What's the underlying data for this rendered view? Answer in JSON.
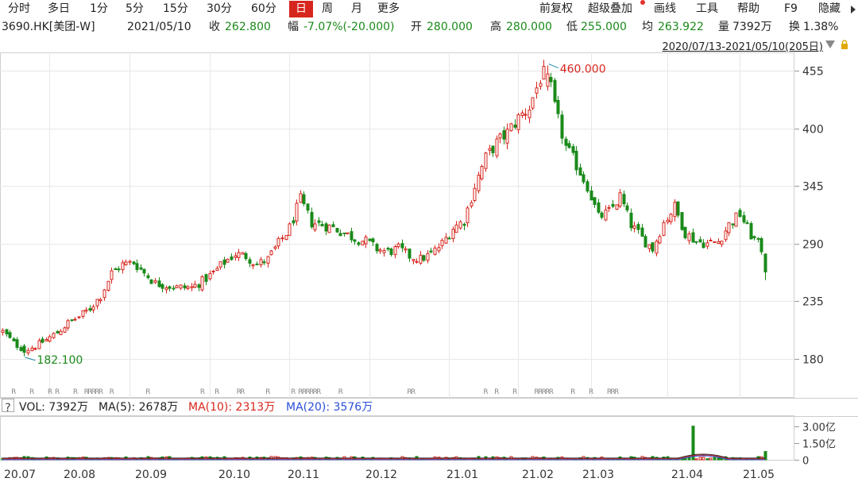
{
  "toolbar": {
    "left_items": [
      "分时",
      "多日",
      "1分",
      "5分",
      "15分",
      "30分",
      "60分",
      "日",
      "周",
      "月",
      "更多"
    ],
    "active": "日",
    "right_items": [
      "前复权",
      "超级叠加",
      "画线",
      "工具",
      "帮助",
      "F9",
      "隐藏"
    ]
  },
  "quote": {
    "code_name": "3690.HK[美团-W]",
    "date": "2021/05/10",
    "close_label": "收",
    "close": "262.800",
    "change_label": "幅",
    "change": "-7.07%(-20.000)",
    "open_label": "开",
    "open": "280.000",
    "high_label": "高",
    "high": "280.000",
    "low_label": "低",
    "low": "255.000",
    "avg_label": "均",
    "avg": "263.922",
    "vol_label": "量",
    "vol": "7392万",
    "turnover_label": "换",
    "turnover": "1.38%"
  },
  "range_text": "2020/07/13-2021/05/10(205日)",
  "volume_indicator": {
    "qmark": "?",
    "vol": "VOL: 7392万",
    "ma5": "MA(5): 2678万",
    "ma10": "MA(10): 2313万",
    "ma20": "MA(20): 3576万"
  },
  "colors": {
    "up": "#d7261e",
    "down": "#1a8a1a",
    "ma5": "#222222",
    "ma10": "#d7261e",
    "ma20": "#2b4fd8"
  },
  "chart_data": {
    "type": "candlestick",
    "title": "",
    "ylim": [
      160,
      468
    ],
    "y_ticks": [
      "455",
      "400",
      "345",
      "290",
      "235",
      "180"
    ],
    "y_tick_values": [
      455,
      400,
      345,
      290,
      235,
      180
    ],
    "x_ticks": [
      "20.07",
      "20.08",
      "20.09",
      "20.10",
      "20.11",
      "20.12",
      "21.01",
      "21.02",
      "21.03",
      "21.04",
      "21.05"
    ],
    "annotations": [
      {
        "text": "460.000",
        "value": 460,
        "color": "#d7261e",
        "kind": "high"
      },
      {
        "text": "182.100",
        "value": 182.1,
        "color": "#1a8a1a",
        "kind": "low"
      }
    ],
    "rights_marker": "R",
    "rights_markers_x_index": [
      2,
      7,
      12,
      14,
      19,
      22,
      23,
      24,
      25,
      26,
      29,
      39,
      54,
      58,
      64,
      65,
      72,
      79,
      81,
      82,
      83,
      84,
      85,
      86,
      92,
      111,
      112,
      132,
      135,
      140,
      146,
      147,
      148,
      149,
      150,
      156,
      161,
      166,
      167,
      168
    ],
    "anchors": [
      [
        0,
        206
      ],
      [
        3,
        195
      ],
      [
        6,
        188
      ],
      [
        9,
        192
      ],
      [
        12,
        198
      ],
      [
        15,
        205
      ],
      [
        18,
        214
      ],
      [
        21,
        220
      ],
      [
        24,
        228
      ],
      [
        27,
        240
      ],
      [
        30,
        262
      ],
      [
        33,
        270
      ],
      [
        36,
        272
      ],
      [
        39,
        262
      ],
      [
        42,
        252
      ],
      [
        45,
        250
      ],
      [
        48,
        248
      ],
      [
        52,
        248
      ],
      [
        55,
        254
      ],
      [
        58,
        262
      ],
      [
        61,
        272
      ],
      [
        64,
        280
      ],
      [
        67,
        278
      ],
      [
        70,
        270
      ],
      [
        73,
        275
      ],
      [
        76,
        290
      ],
      [
        79,
        305
      ],
      [
        82,
        332
      ],
      [
        85,
        310
      ],
      [
        88,
        308
      ],
      [
        91,
        305
      ],
      [
        94,
        300
      ],
      [
        97,
        295
      ],
      [
        100,
        292
      ],
      [
        103,
        285
      ],
      [
        106,
        282
      ],
      [
        109,
        285
      ],
      [
        112,
        278
      ],
      [
        115,
        275
      ],
      [
        118,
        280
      ],
      [
        121,
        290
      ],
      [
        124,
        305
      ],
      [
        127,
        312
      ],
      [
        130,
        345
      ],
      [
        133,
        372
      ],
      [
        136,
        386
      ],
      [
        139,
        396
      ],
      [
        142,
        410
      ],
      [
        145,
        420
      ],
      [
        148,
        448
      ],
      [
        150,
        455
      ],
      [
        152,
        420
      ],
      [
        155,
        382
      ],
      [
        158,
        365
      ],
      [
        161,
        345
      ],
      [
        164,
        315
      ],
      [
        167,
        320
      ],
      [
        170,
        335
      ],
      [
        173,
        308
      ],
      [
        176,
        295
      ],
      [
        179,
        285
      ],
      [
        182,
        310
      ],
      [
        185,
        325
      ],
      [
        188,
        300
      ],
      [
        191,
        292
      ],
      [
        194,
        290
      ],
      [
        197,
        292
      ],
      [
        200,
        308
      ],
      [
        203,
        318
      ],
      [
        206,
        298
      ],
      [
        209,
        285
      ],
      [
        210,
        262.8
      ]
    ],
    "volume": {
      "ylim": [
        0,
        3.4
      ],
      "y_ticks": [
        "3.00亿",
        "1.50亿",
        "0"
      ],
      "y_tick_values": [
        3.0,
        1.5,
        0
      ],
      "unit": "亿",
      "spike_index": 190,
      "spike_value": 3.0,
      "last_value": 0.74
    }
  }
}
